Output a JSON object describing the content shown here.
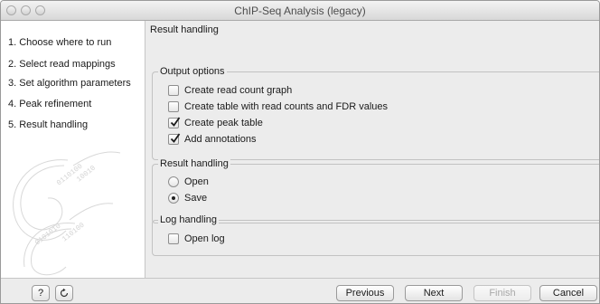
{
  "window": {
    "title": "ChIP-Seq Analysis (legacy)"
  },
  "sidebar": {
    "steps": [
      {
        "label": "1.  Choose where to run"
      },
      {
        "label": "2.  Select read mappings"
      },
      {
        "label": "3.  Set algorithm parameters"
      },
      {
        "label": "4.  Peak refinement"
      },
      {
        "label": "5.  Result handling"
      }
    ]
  },
  "content": {
    "title": "Result handling",
    "output_options": {
      "legend": "Output options",
      "items": [
        {
          "label": "Create read count graph",
          "checked": false
        },
        {
          "label": "Create table with read counts and FDR values",
          "checked": false
        },
        {
          "label": "Create peak table",
          "checked": true
        },
        {
          "label": "Add annotations",
          "checked": true
        }
      ]
    },
    "result_handling": {
      "legend": "Result handling",
      "options": [
        {
          "label": "Open",
          "selected": false
        },
        {
          "label": "Save",
          "selected": true
        }
      ]
    },
    "log_handling": {
      "legend": "Log handling",
      "items": [
        {
          "label": "Open log",
          "checked": false
        }
      ]
    }
  },
  "buttons": {
    "help": "?",
    "previous": "Previous",
    "next": "Next",
    "finish": "Finish",
    "cancel": "Cancel"
  }
}
